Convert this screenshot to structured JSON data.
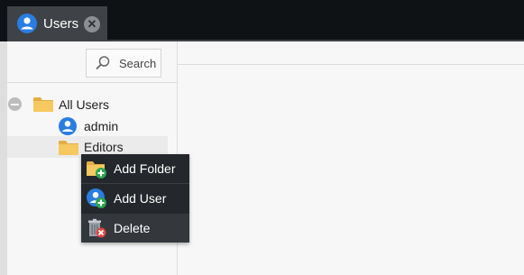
{
  "tab": {
    "label": "Users",
    "close_icon": "close-icon"
  },
  "search": {
    "label": "Search",
    "icon": "search-icon"
  },
  "tree": {
    "root": {
      "label": "All Users",
      "icon": "folder-icon",
      "expanded": true
    },
    "items": [
      {
        "label": "admin",
        "icon": "user-icon"
      },
      {
        "label": "Editors",
        "icon": "folder-icon",
        "selected": true
      }
    ]
  },
  "context_menu": {
    "items": [
      {
        "label": "Add Folder",
        "icon": "add-folder-icon"
      },
      {
        "label": "Add User",
        "icon": "add-user-icon"
      },
      {
        "label": "Delete",
        "icon": "delete-trash-icon"
      }
    ]
  },
  "colors": {
    "topbar": "#0f1215",
    "tab": "#3f4246",
    "menu_bg": "#24272b",
    "folder": "#f2c15d",
    "user_blue": "#2a7de1",
    "add_green": "#2ea44f",
    "delete_red": "#e04545"
  }
}
